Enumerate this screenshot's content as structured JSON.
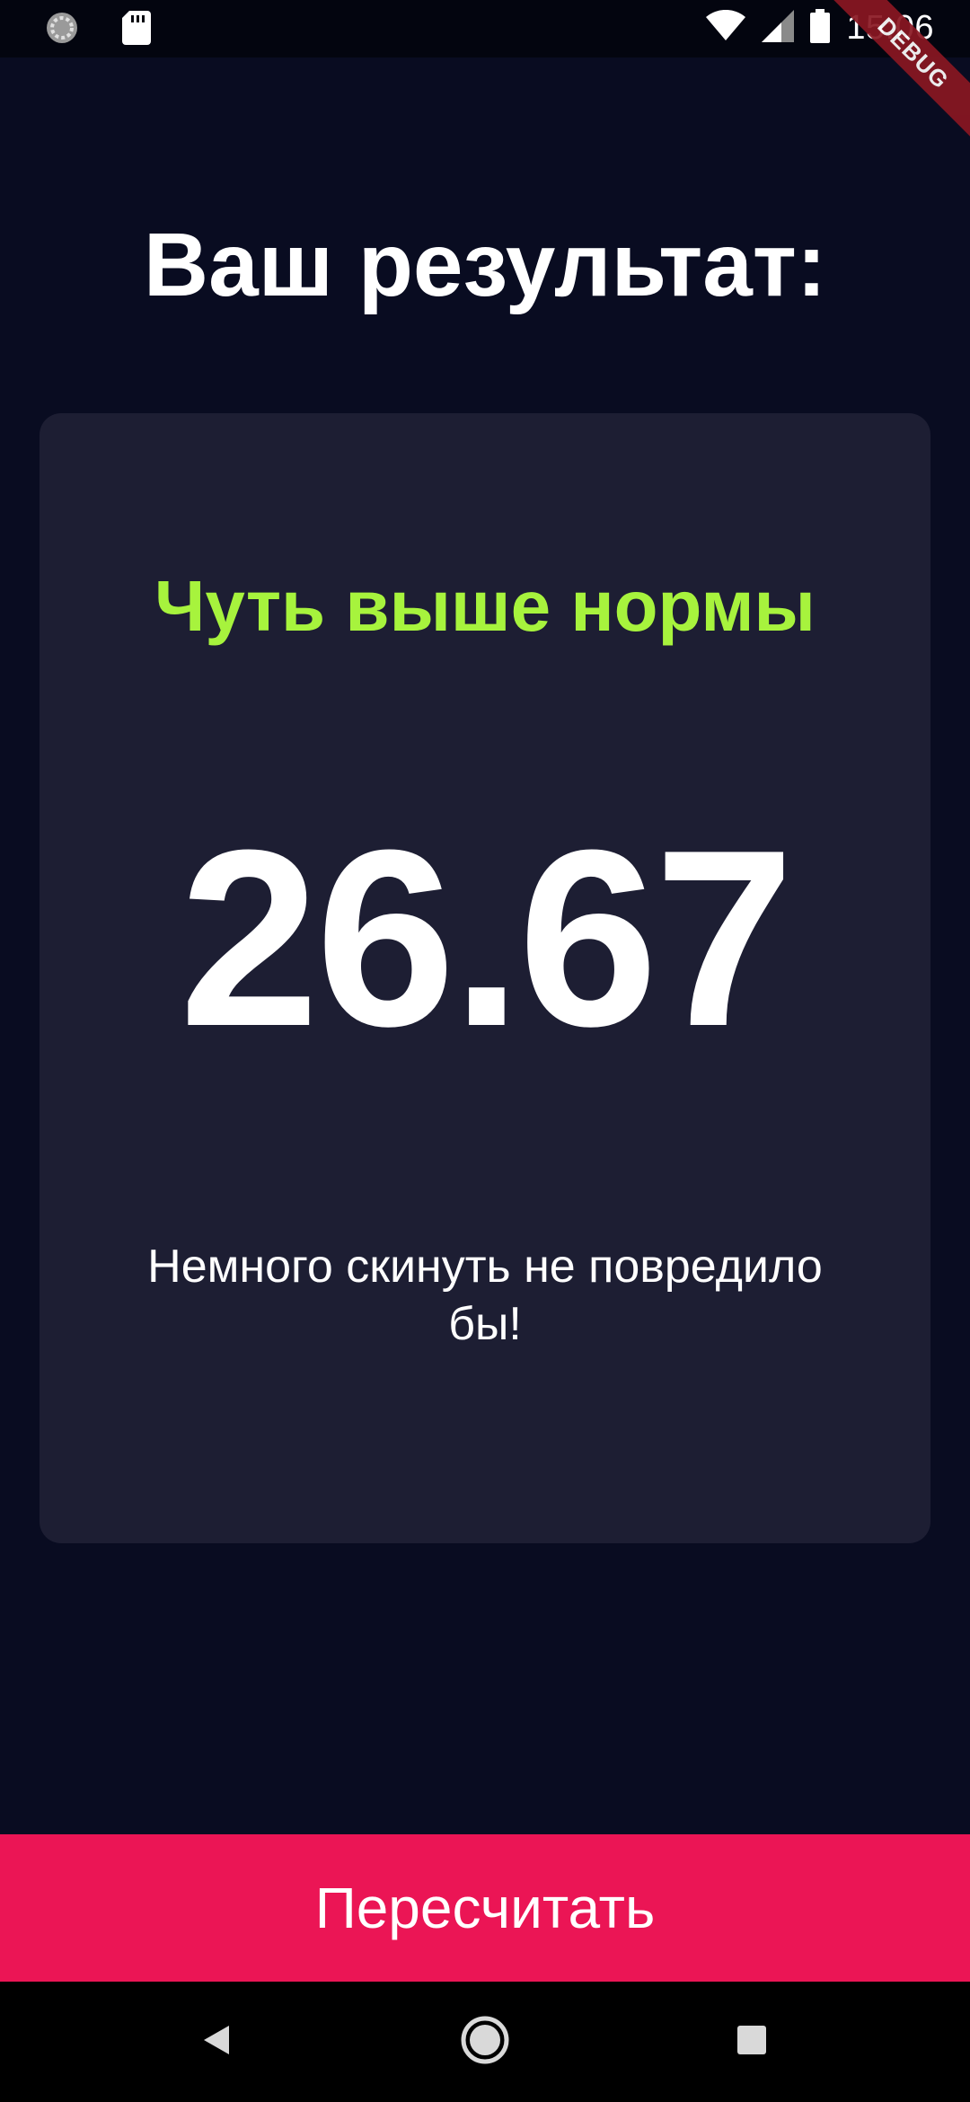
{
  "status_bar": {
    "time": "15:06",
    "icons": [
      "loading-circle-icon",
      "sd-card-icon",
      "wifi-icon",
      "cell-signal-icon",
      "battery-icon"
    ]
  },
  "debug_banner": "DEBUG",
  "title": "Ваш результат:",
  "result": {
    "status": "Чуть выше нормы",
    "bmi": "26.67",
    "advice": "Немного скинуть не повредило бы!"
  },
  "recalculate_label": "Пересчитать",
  "colors": {
    "background": "#090c21",
    "card": "#1d1e33",
    "status_green": "#a7f33d",
    "button_pink": "#eb1555"
  },
  "nav_bar": {
    "icons": [
      "back-icon",
      "home-icon",
      "recents-icon"
    ]
  }
}
